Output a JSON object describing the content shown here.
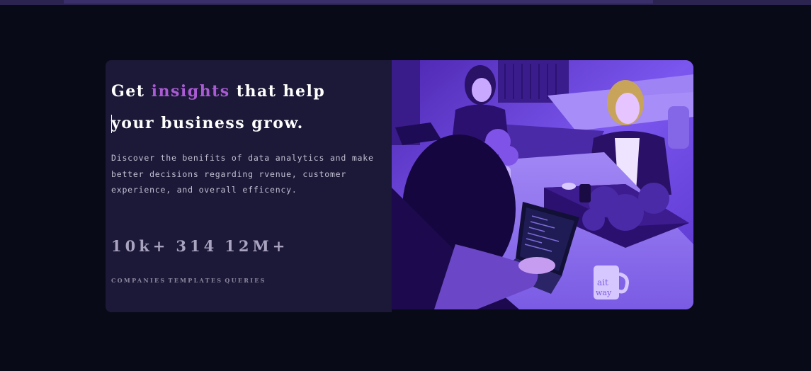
{
  "hero": {
    "headline_pre": "Get ",
    "headline_accent": "insights",
    "headline_post": " that help your business grow.",
    "description": "Discover the benifits of data analytics and make better decisions regarding rvenue, customer experience, and overall efficency.",
    "stats": [
      {
        "value": "10k+",
        "label": "COMPANIES"
      },
      {
        "value": "314",
        "label": "TEMPLATES"
      },
      {
        "value": "12M+",
        "label": "QUERIES"
      }
    ],
    "mug_text": "ait\nway"
  },
  "colors": {
    "background": "#090a17",
    "card": "#1b1937",
    "accent": "#aa5bd3",
    "image_tint": "#6a3fe0"
  }
}
